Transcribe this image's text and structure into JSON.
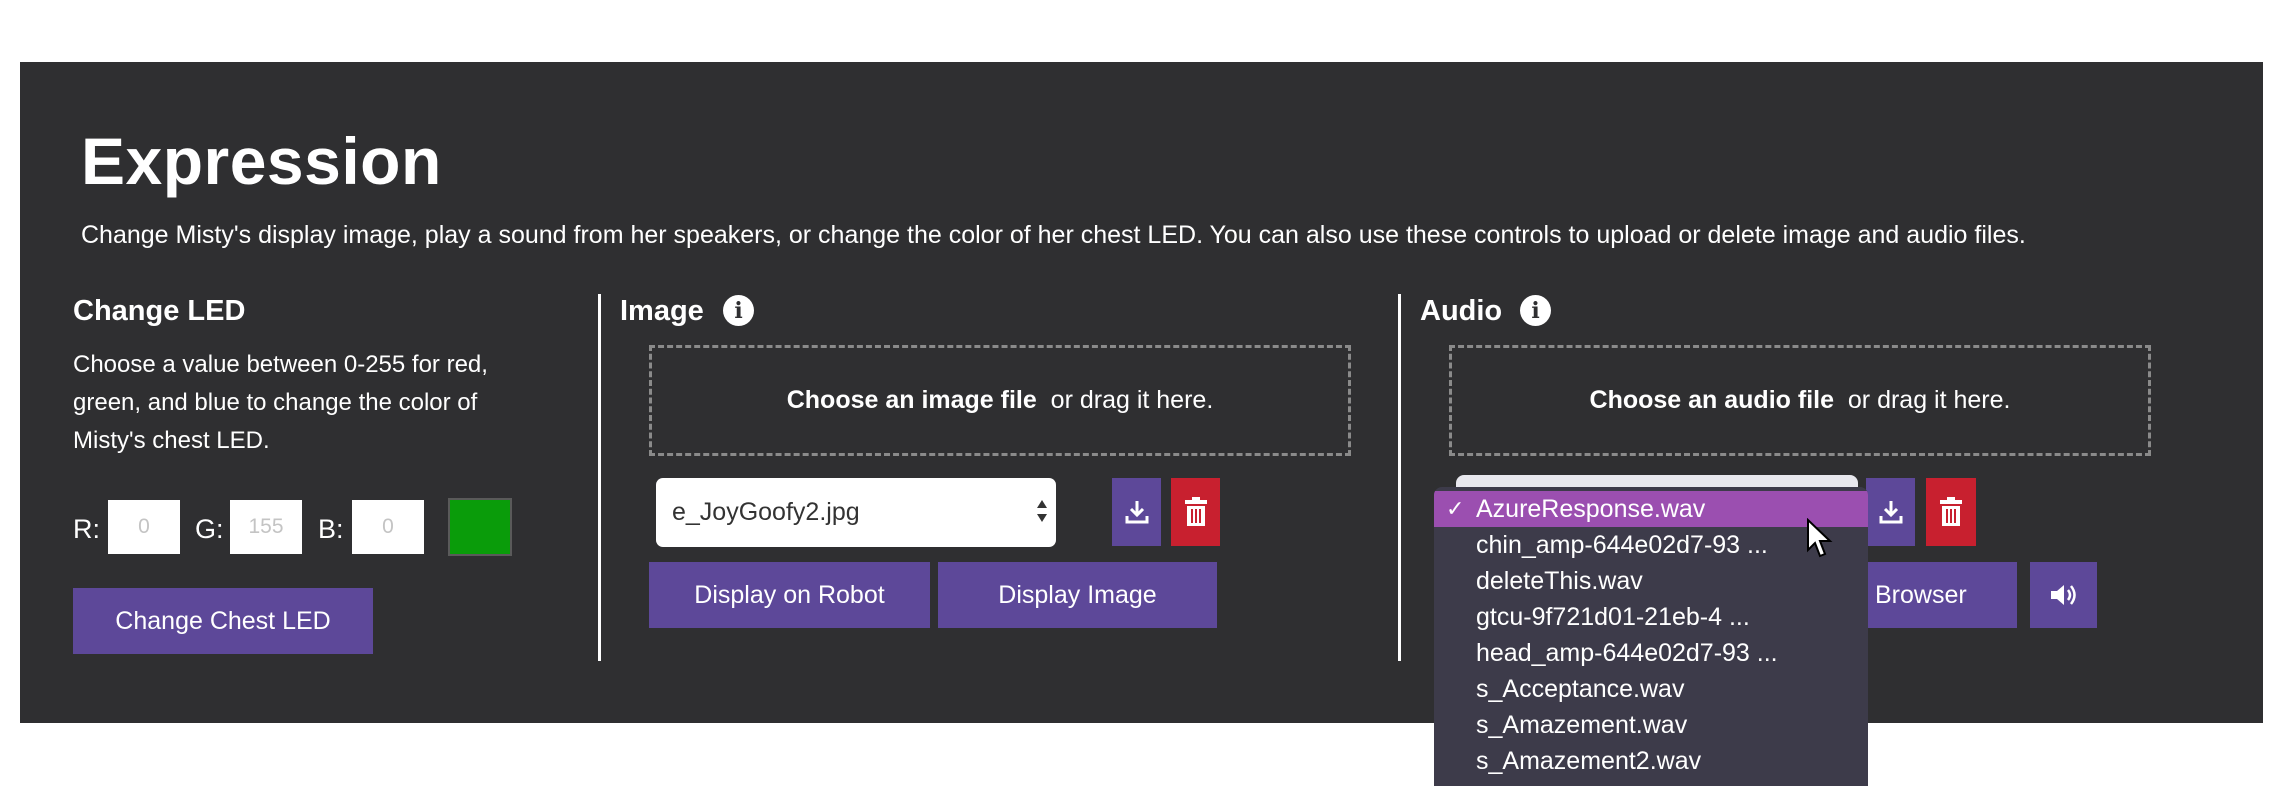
{
  "header": {
    "title": "Expression",
    "description": "Change Misty's display image, play a sound from her speakers, or change the color of her chest LED. You can also use these controls to upload or delete image and audio files."
  },
  "led": {
    "heading": "Change LED",
    "description": "Choose a value between 0-255 for red, green, and blue to change the color of Misty's chest LED.",
    "r_label": "R:",
    "g_label": "G:",
    "b_label": "B:",
    "r_value": "0",
    "g_value": "155",
    "b_value": "0",
    "swatch_color": "#0a9c0a",
    "button_label": "Change Chest LED"
  },
  "image": {
    "heading": "Image",
    "drop_bold": "Choose an image file",
    "drop_rest": "  or drag it here.",
    "selected_file": "e_JoyGoofy2.jpg",
    "display_robot_label": "Display on Robot",
    "display_image_label": "Display Image"
  },
  "audio": {
    "heading": "Audio",
    "drop_bold": "Choose an audio file",
    "drop_rest": "  or drag it here.",
    "browser_label": "Browser",
    "options": [
      "AzureResponse.wav",
      "chin_amp-644e02d7-93 ...",
      "deleteThis.wav",
      "gtcu-9f721d01-21eb-4 ...",
      "head_amp-644e02d7-93 ...",
      "s_Acceptance.wav",
      "s_Amazement.wav",
      "s_Amazement2.wav"
    ],
    "selected_index": 0
  },
  "colors": {
    "panel_bg": "#2f2f31",
    "accent_purple": "#5d4899",
    "danger_red": "#c8202f",
    "menu_highlight": "#9b4fb0"
  },
  "icons": [
    "info-icon",
    "download-icon",
    "trash-icon",
    "speaker-icon",
    "checkmark-icon",
    "cursor-icon",
    "select-arrows-icon"
  ]
}
